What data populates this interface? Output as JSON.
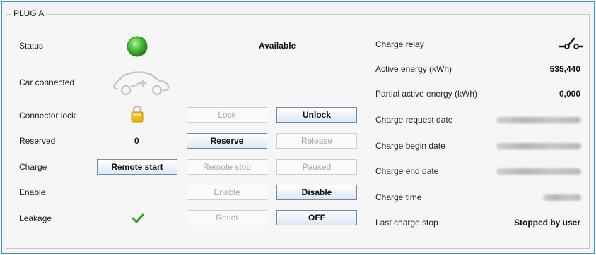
{
  "panel": {
    "title": "PLUG A"
  },
  "left": {
    "status": {
      "label": "Status",
      "value": "Available",
      "indicator_color": "#3fb832"
    },
    "car_connected": {
      "label": "Car connected"
    },
    "connector_lock": {
      "label": "Connector lock",
      "lock_button": "Lock",
      "unlock_button": "Unlock"
    },
    "reserved": {
      "label": "Reserved",
      "value": "0",
      "reserve_button": "Reserve",
      "release_button": "Release"
    },
    "charge": {
      "label": "Charge",
      "remote_start_button": "Remote start",
      "remote_stop_button": "Remote stop",
      "paused_button": "Paused"
    },
    "enable": {
      "label": "Enable",
      "enable_button": "Enable",
      "disable_button": "Disable"
    },
    "leakage": {
      "label": "Leakage",
      "reset_button": "Reset",
      "off_button": "OFF"
    }
  },
  "right": {
    "charge_relay": {
      "label": "Charge relay"
    },
    "active_energy": {
      "label": "Active energy (kWh)",
      "value": "535,440"
    },
    "partial_active_energy": {
      "label": "Partial active energy (kWh)",
      "value": "0,000"
    },
    "charge_request_date": {
      "label": "Charge request date"
    },
    "charge_begin_date": {
      "label": "Charge begin date"
    },
    "charge_end_date": {
      "label": "Charge end date"
    },
    "charge_time": {
      "label": "Charge time"
    },
    "last_charge_stop": {
      "label": "Last charge stop",
      "value": "Stopped by user"
    }
  },
  "colors": {
    "frame_border": "#3a93c9",
    "check_green": "#3aa02a",
    "lock_gold": "#f0b81c"
  }
}
